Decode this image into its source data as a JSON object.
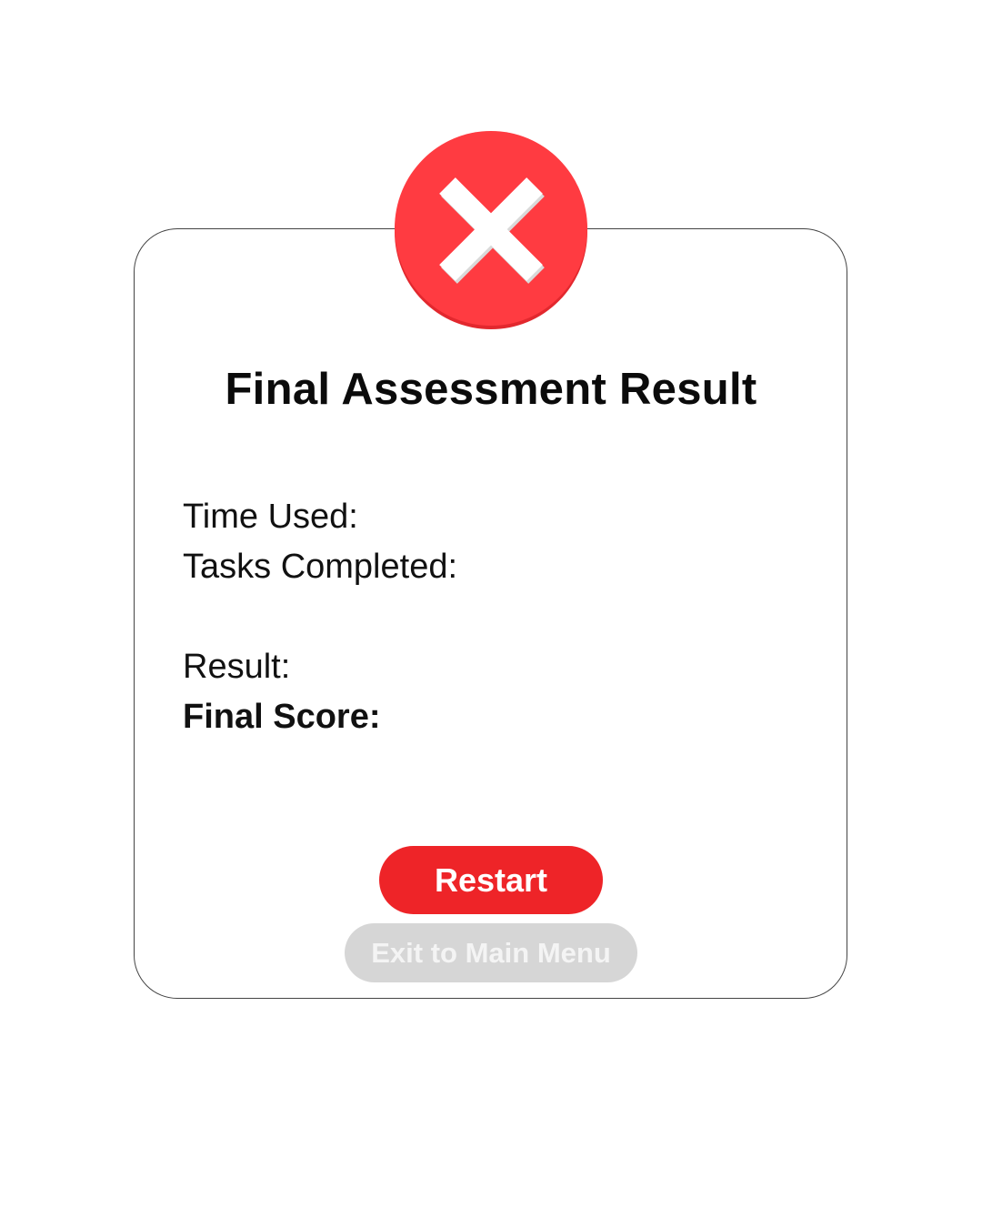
{
  "dialog": {
    "status_icon": "error-x-icon",
    "title": "Final Assessment Result",
    "stats": {
      "time_used_label": "Time Used:",
      "tasks_completed_label": "Tasks Completed:",
      "result_label": "Result:",
      "final_score_label": "Final Score:"
    },
    "buttons": {
      "restart_label": "Restart",
      "exit_label": "Exit to Main Menu"
    }
  },
  "colors": {
    "error_red": "#ff3b41",
    "primary_button": "#ee2428",
    "disabled_button": "#d6d6d6",
    "icon_x": "#ffffff"
  }
}
